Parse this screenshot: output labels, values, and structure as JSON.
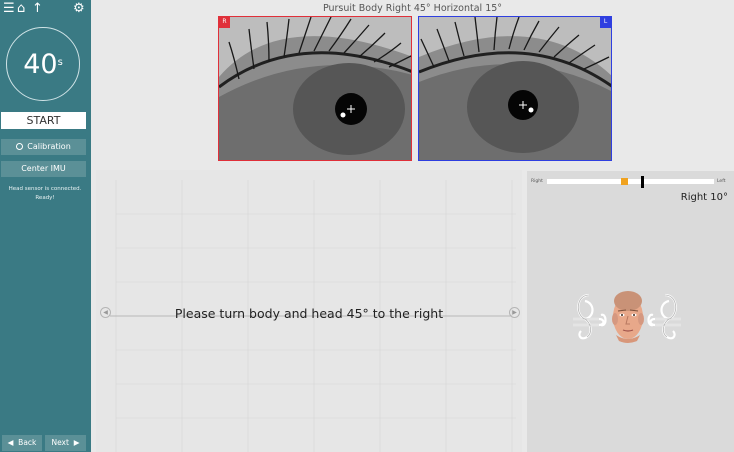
{
  "sidebar": {
    "icons": [
      "menu-icon",
      "home-icon",
      "up-arrow-icon",
      "gear-icon"
    ],
    "timer": {
      "value": "40",
      "unit": "s"
    },
    "start_label": "START",
    "calibration_label": "Calibration",
    "center_imu_label": "Center IMU",
    "status": "Head sensor is connected. Ready!",
    "back_label": "Back",
    "next_label": "Next"
  },
  "main": {
    "test_title": "Pursuit Body Right 45° Horizontal 15°",
    "eyes": {
      "right_tag": "R",
      "left_tag": "L",
      "right_color": "#e0303a",
      "left_color": "#2f3fe0"
    },
    "graph": {
      "instruction": "Please turn body and head 45° to the right"
    }
  },
  "head_panel": {
    "right_label": "Right",
    "left_label": "Left",
    "readout": "Right 10°",
    "marker_color": "#f0a21f"
  }
}
